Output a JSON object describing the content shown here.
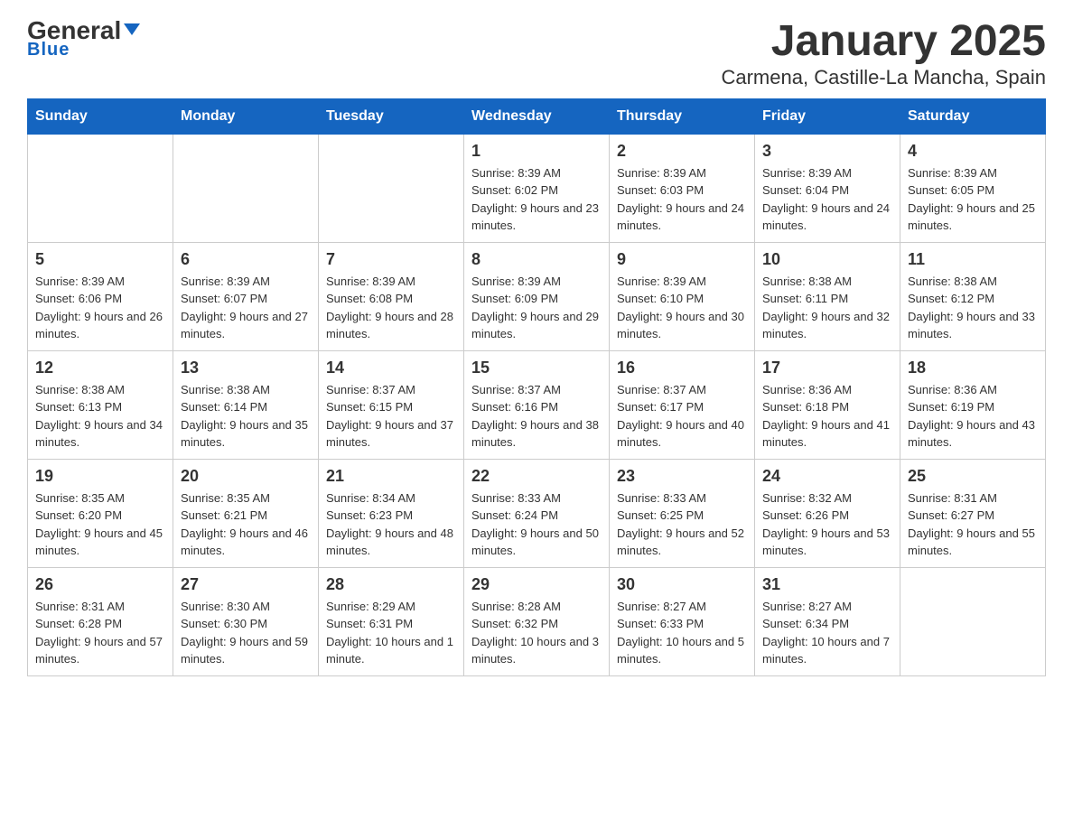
{
  "header": {
    "logo_general": "General",
    "logo_blue": "Blue",
    "title": "January 2025",
    "subtitle": "Carmena, Castille-La Mancha, Spain"
  },
  "days_of_week": [
    "Sunday",
    "Monday",
    "Tuesday",
    "Wednesday",
    "Thursday",
    "Friday",
    "Saturday"
  ],
  "weeks": [
    [
      {
        "day": "",
        "info": ""
      },
      {
        "day": "",
        "info": ""
      },
      {
        "day": "",
        "info": ""
      },
      {
        "day": "1",
        "info": "Sunrise: 8:39 AM\nSunset: 6:02 PM\nDaylight: 9 hours and 23 minutes."
      },
      {
        "day": "2",
        "info": "Sunrise: 8:39 AM\nSunset: 6:03 PM\nDaylight: 9 hours and 24 minutes."
      },
      {
        "day": "3",
        "info": "Sunrise: 8:39 AM\nSunset: 6:04 PM\nDaylight: 9 hours and 24 minutes."
      },
      {
        "day": "4",
        "info": "Sunrise: 8:39 AM\nSunset: 6:05 PM\nDaylight: 9 hours and 25 minutes."
      }
    ],
    [
      {
        "day": "5",
        "info": "Sunrise: 8:39 AM\nSunset: 6:06 PM\nDaylight: 9 hours and 26 minutes."
      },
      {
        "day": "6",
        "info": "Sunrise: 8:39 AM\nSunset: 6:07 PM\nDaylight: 9 hours and 27 minutes."
      },
      {
        "day": "7",
        "info": "Sunrise: 8:39 AM\nSunset: 6:08 PM\nDaylight: 9 hours and 28 minutes."
      },
      {
        "day": "8",
        "info": "Sunrise: 8:39 AM\nSunset: 6:09 PM\nDaylight: 9 hours and 29 minutes."
      },
      {
        "day": "9",
        "info": "Sunrise: 8:39 AM\nSunset: 6:10 PM\nDaylight: 9 hours and 30 minutes."
      },
      {
        "day": "10",
        "info": "Sunrise: 8:38 AM\nSunset: 6:11 PM\nDaylight: 9 hours and 32 minutes."
      },
      {
        "day": "11",
        "info": "Sunrise: 8:38 AM\nSunset: 6:12 PM\nDaylight: 9 hours and 33 minutes."
      }
    ],
    [
      {
        "day": "12",
        "info": "Sunrise: 8:38 AM\nSunset: 6:13 PM\nDaylight: 9 hours and 34 minutes."
      },
      {
        "day": "13",
        "info": "Sunrise: 8:38 AM\nSunset: 6:14 PM\nDaylight: 9 hours and 35 minutes."
      },
      {
        "day": "14",
        "info": "Sunrise: 8:37 AM\nSunset: 6:15 PM\nDaylight: 9 hours and 37 minutes."
      },
      {
        "day": "15",
        "info": "Sunrise: 8:37 AM\nSunset: 6:16 PM\nDaylight: 9 hours and 38 minutes."
      },
      {
        "day": "16",
        "info": "Sunrise: 8:37 AM\nSunset: 6:17 PM\nDaylight: 9 hours and 40 minutes."
      },
      {
        "day": "17",
        "info": "Sunrise: 8:36 AM\nSunset: 6:18 PM\nDaylight: 9 hours and 41 minutes."
      },
      {
        "day": "18",
        "info": "Sunrise: 8:36 AM\nSunset: 6:19 PM\nDaylight: 9 hours and 43 minutes."
      }
    ],
    [
      {
        "day": "19",
        "info": "Sunrise: 8:35 AM\nSunset: 6:20 PM\nDaylight: 9 hours and 45 minutes."
      },
      {
        "day": "20",
        "info": "Sunrise: 8:35 AM\nSunset: 6:21 PM\nDaylight: 9 hours and 46 minutes."
      },
      {
        "day": "21",
        "info": "Sunrise: 8:34 AM\nSunset: 6:23 PM\nDaylight: 9 hours and 48 minutes."
      },
      {
        "day": "22",
        "info": "Sunrise: 8:33 AM\nSunset: 6:24 PM\nDaylight: 9 hours and 50 minutes."
      },
      {
        "day": "23",
        "info": "Sunrise: 8:33 AM\nSunset: 6:25 PM\nDaylight: 9 hours and 52 minutes."
      },
      {
        "day": "24",
        "info": "Sunrise: 8:32 AM\nSunset: 6:26 PM\nDaylight: 9 hours and 53 minutes."
      },
      {
        "day": "25",
        "info": "Sunrise: 8:31 AM\nSunset: 6:27 PM\nDaylight: 9 hours and 55 minutes."
      }
    ],
    [
      {
        "day": "26",
        "info": "Sunrise: 8:31 AM\nSunset: 6:28 PM\nDaylight: 9 hours and 57 minutes."
      },
      {
        "day": "27",
        "info": "Sunrise: 8:30 AM\nSunset: 6:30 PM\nDaylight: 9 hours and 59 minutes."
      },
      {
        "day": "28",
        "info": "Sunrise: 8:29 AM\nSunset: 6:31 PM\nDaylight: 10 hours and 1 minute."
      },
      {
        "day": "29",
        "info": "Sunrise: 8:28 AM\nSunset: 6:32 PM\nDaylight: 10 hours and 3 minutes."
      },
      {
        "day": "30",
        "info": "Sunrise: 8:27 AM\nSunset: 6:33 PM\nDaylight: 10 hours and 5 minutes."
      },
      {
        "day": "31",
        "info": "Sunrise: 8:27 AM\nSunset: 6:34 PM\nDaylight: 10 hours and 7 minutes."
      },
      {
        "day": "",
        "info": ""
      }
    ]
  ]
}
